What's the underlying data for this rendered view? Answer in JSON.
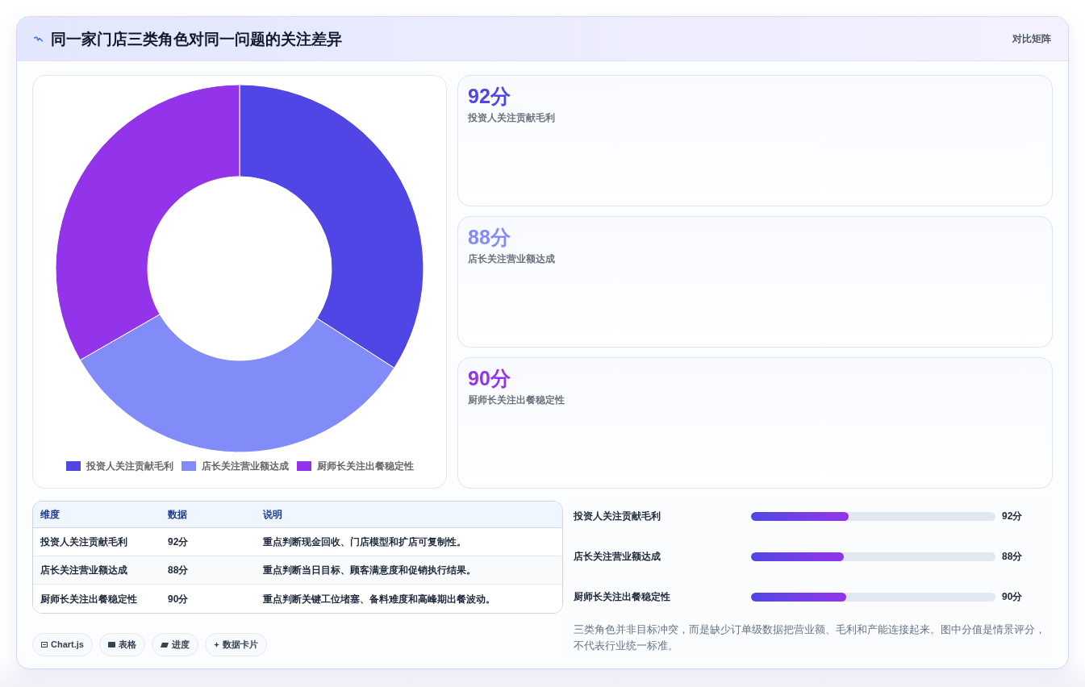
{
  "header": {
    "title": "同一家门店三类角色对同一问题的关注差异",
    "badge": "对比矩阵"
  },
  "chart": {
    "chart_data": {
      "type": "donut",
      "categories": [
        "投资人关注贡献毛利",
        "店长关注营业额达成",
        "厨师长关注出餐稳定性"
      ],
      "values": [
        34.1,
        32.6,
        33.3
      ],
      "colors": [
        "#4f46e5",
        "#818cf8",
        "#9333ea"
      ],
      "legend": "bottom"
    }
  },
  "stat_cards": [
    {
      "value": "92分",
      "label": "投资人关注贡献毛利",
      "color": "#4f46e5"
    },
    {
      "value": "88分",
      "label": "店长关注营业额达成",
      "color": "#818cf8"
    },
    {
      "value": "90分",
      "label": "厨师长关注出餐稳定性",
      "color": "#9333ea"
    }
  ],
  "table": {
    "columns": [
      "维度",
      "数据",
      "说明"
    ],
    "rows": [
      [
        "投资人关注贡献毛利",
        "92分",
        "重点判断现金回收、门店模型和扩店可复制性。"
      ],
      [
        "店长关注营业额达成",
        "88分",
        "重点判断当日目标、顾客满意度和促销执行结果。"
      ],
      [
        "厨师长关注出餐稳定性",
        "90分",
        "重点判断关键工位堵塞、备料难度和高峰期出餐波动。"
      ]
    ]
  },
  "progress": [
    {
      "label": "投资人关注贡献毛利",
      "level": 0.4,
      "reading": "92分"
    },
    {
      "label": "店长关注营业额达成",
      "level": 0.38,
      "reading": "88分"
    },
    {
      "label": "厨师长关注出餐稳定性",
      "level": 0.39,
      "reading": "90分"
    }
  ],
  "tags": [
    {
      "kind": "chart",
      "label": "Chart.js"
    },
    {
      "kind": "table",
      "label": "表格"
    },
    {
      "kind": "progress",
      "label": "进度"
    },
    {
      "kind": "card",
      "label": "数据卡片"
    }
  ],
  "note": "三类角色并非目标冲突，而是缺少订单级数据把营业额、毛利和产能连接起来。图中分值是情景评分，不代表行业统一标准。"
}
